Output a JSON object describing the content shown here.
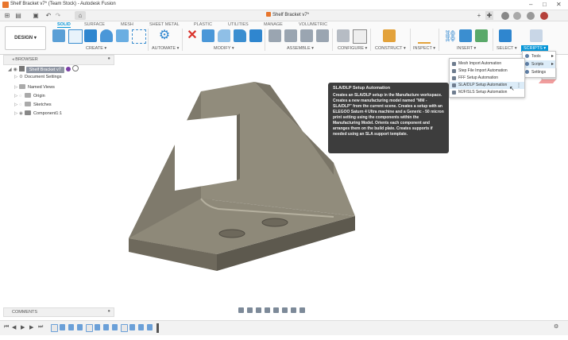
{
  "window": {
    "title": "Shelf Bracket v7* (Team Stock) - Autodesk Fusion",
    "document_tab": "Shelf Bracket v7*",
    "controls": [
      "–",
      "□",
      "✕"
    ]
  },
  "workspace": {
    "label": "DESIGN"
  },
  "ribbon": {
    "tabs": [
      "SOLID",
      "SURFACE",
      "MESH",
      "SHEET METAL",
      "PLASTIC",
      "UTILITIES",
      "MANAGE",
      "VOLUMETRIC"
    ],
    "active_tab": "SOLID",
    "groups": [
      "CREATE",
      "AUTOMATE",
      "MODIFY",
      "ASSEMBLE",
      "CONFIGURE",
      "CONSTRUCT",
      "INSPECT",
      "INSERT",
      "SELECT",
      "SCRIPTS"
    ]
  },
  "browser": {
    "title": "BROWSER",
    "root": "Shelf Bracket v7",
    "items": [
      "Document Settings",
      "Named Views",
      "Origin",
      "Sketches",
      "Component1:1"
    ]
  },
  "comments": {
    "title": "COMMENTS"
  },
  "submenu": {
    "items": [
      "Tools",
      "Scripts",
      "Settings"
    ],
    "highlighted": "Scripts"
  },
  "dropdown": {
    "items": [
      "Mesh Import Automation",
      "Step File Import Automation",
      "FFF Setup Automation",
      "SLA/DLP Setup Automation",
      "MJF/SLS Setup Automation"
    ],
    "highlighted": "SLA/DLP Setup Automation"
  },
  "tooltip": {
    "title": "SLA/DLP Setup Automation",
    "body": "Creates an SLA/DLP setup in the Manufacture workspace. Creates a new manufacturing model named \"MM - SLA/DLP\" from the current scene. Creates a setup with an ELEGOO Saturn 4 Ultra machine and a Generic - 50 micron print setting using the components within the Manufacturing Model. Orients each component and arranges them on the build plate. Creates supports if needed using an SLA support template."
  },
  "colors": {
    "accent": "#0696d7",
    "brand": "#e8762d",
    "model_face": "#8f8a7b",
    "model_dark": "#5f5b50"
  },
  "icons": {
    "undo": "undo-icon",
    "redo": "redo-icon",
    "home": "home-icon",
    "grid": "app-grid-icon",
    "save": "save-icon",
    "file": "file-icon"
  }
}
